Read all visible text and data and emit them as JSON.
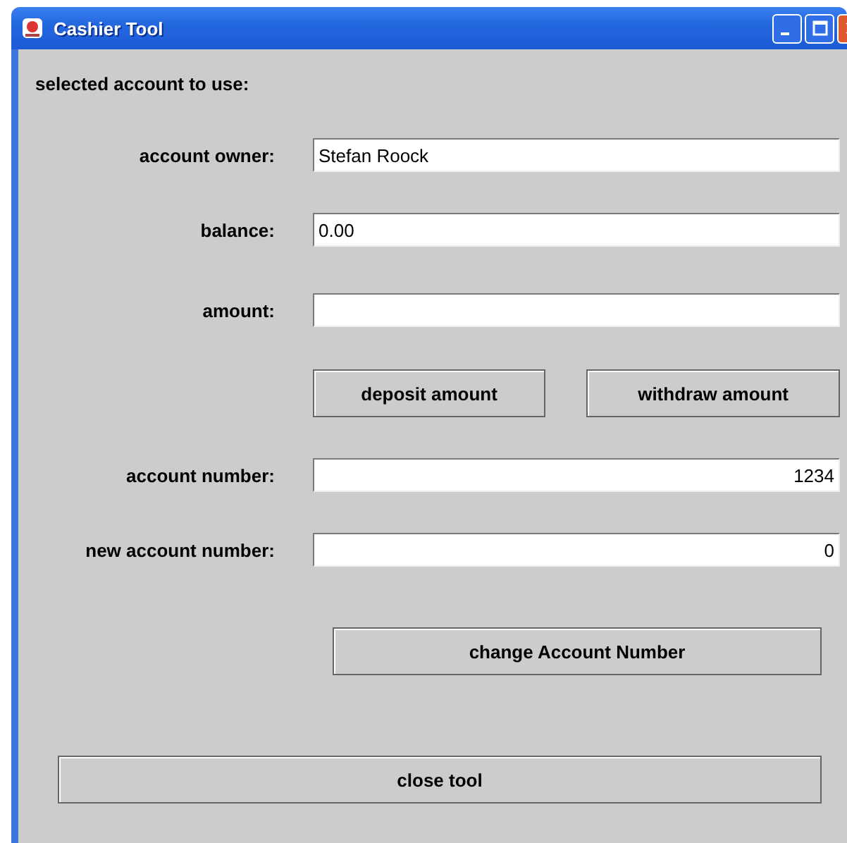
{
  "window": {
    "title": "Cashier Tool"
  },
  "heading": "selected account to use:",
  "fields": [
    {
      "label": "account owner:",
      "value": "Stefan Roock"
    },
    {
      "label": "balance:",
      "value": "0.00"
    },
    {
      "label": "amount:"
    }
  ],
  "amount_buttons": [
    "deposit amount",
    "withdraw amount"
  ],
  "number_fields": [
    {
      "label": "account number:",
      "value": "1234"
    },
    {
      "label": "new account number:",
      "value": "0"
    }
  ],
  "change_button": "change Account Number",
  "close_button": "close tool"
}
